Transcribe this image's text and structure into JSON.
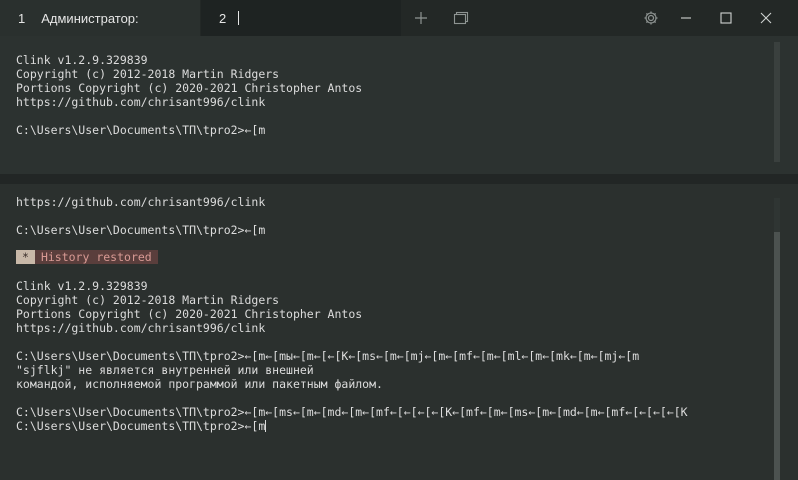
{
  "tabs": [
    {
      "number": "1",
      "label": "Администратор:"
    },
    {
      "number": "2",
      "label": ""
    }
  ],
  "icons": {
    "new_tab": "plus-icon",
    "tab_switcher": "overview-icon",
    "settings": "gear-icon",
    "minimize": "minimize-icon",
    "maximize": "maximize-icon",
    "close": "close-icon"
  },
  "pane1": {
    "lines": [
      "Clink v1.2.9.329839",
      "Copyright (c) 2012-2018 Martin Ridgers",
      "Portions Copyright (c) 2020-2021 Christopher Antos",
      "https://github.com/chrisant996/clink",
      "",
      "C:\\Users\\User\\Documents\\ТП\\tpro2>←[m"
    ]
  },
  "pane2": {
    "line_url_top": "https://github.com/chrisant996/clink",
    "prompt_1": "C:\\Users\\User\\Documents\\ТП\\tpro2>←[m",
    "badge_star": "*",
    "badge_text": "History restored",
    "lines": [
      "Clink v1.2.9.329839",
      "Copyright (c) 2012-2018 Martin Ridgers",
      "Portions Copyright (c) 2020-2021 Christopher Antos",
      "https://github.com/chrisant996/clink",
      "",
      "C:\\Users\\User\\Documents\\ТП\\tpro2>←[m←[mы←[m←[←[K←[ms←[m←[mj←[m←[mf←[m←[ml←[m←[mk←[m←[mj←[m",
      "\"sjflkj\" не является внутренней или внешней",
      "командой, исполняемой программой или пакетным файлом.",
      "",
      "C:\\Users\\User\\Documents\\ТП\\tpro2>←[m←[ms←[m←[md←[m←[mf←[←[←[←[K←[mf←[m←[ms←[m←[md←[m←[mf←[←[←[←[K",
      "C:\\Users\\User\\Documents\\ТП\\tpro2>←[m"
    ]
  }
}
